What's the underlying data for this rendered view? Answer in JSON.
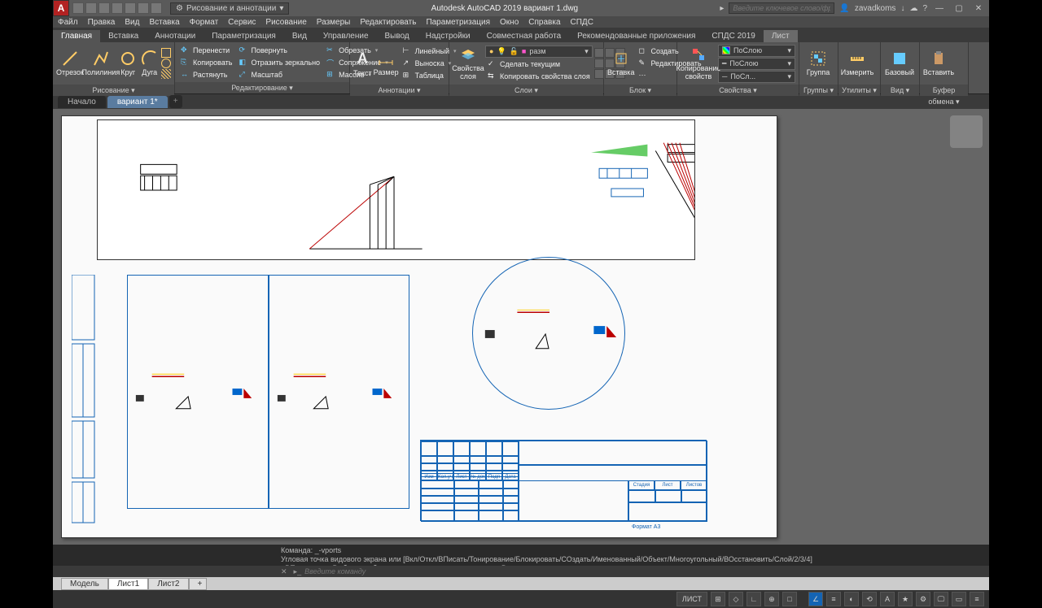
{
  "app_logo": "A",
  "workspace": "Рисование и аннотации",
  "title": "Autodesk AutoCAD 2019   вариант 1.dwg",
  "search_ph": "Введите ключевое слово/фразу",
  "user": "zavadkoms",
  "menu": [
    "Файл",
    "Правка",
    "Вид",
    "Вставка",
    "Формат",
    "Сервис",
    "Рисование",
    "Размеры",
    "Редактировать",
    "Параметризация",
    "Окно",
    "Справка",
    "СПДС"
  ],
  "ribbon_tabs": [
    "Главная",
    "Вставка",
    "Аннотации",
    "Параметризация",
    "Вид",
    "Управление",
    "Вывод",
    "Надстройки",
    "Совместная работа",
    "Рекомендованные приложения",
    "СПДС 2019",
    "Лист"
  ],
  "active_rtab": 0,
  "panels": {
    "draw": {
      "title": "Рисование ▾",
      "btns": [
        "Отрезок",
        "Полилиния",
        "Круг",
        "Дуга"
      ]
    },
    "modify": {
      "title": "Редактирование ▾",
      "items": [
        "Перенести",
        "Повернуть",
        "Обрезать",
        "Копировать",
        "Отразить зеркально",
        "Сопряжение",
        "Растянуть",
        "Масштаб",
        "Массив"
      ]
    },
    "annot": {
      "title": "Аннотации ▾",
      "btns": [
        "Текст",
        "Размер"
      ],
      "items": [
        "Линейный",
        "Выноска",
        "Таблица"
      ]
    },
    "layers": {
      "title": "Слои ▾",
      "btn": "Свойства слоя",
      "items": [
        "разм",
        "Сделать текущим",
        "Копировать свойства слоя"
      ]
    },
    "block": {
      "title": "Блок ▾",
      "btns": [
        "Вставка",
        "Создать",
        "Редактировать"
      ]
    },
    "prop": {
      "title": "Свойства ▾",
      "btn": "Копирование свойств",
      "combos": [
        "ПоСлою",
        "ПоСлою",
        "ПоСл..."
      ]
    },
    "groups": {
      "title": "Группы ▾",
      "btn": "Группа"
    },
    "util": {
      "title": "Утилиты ▾",
      "btn": "Измерить"
    },
    "view": {
      "title": "Вид ▾",
      "btn": "Базовый"
    },
    "clip": {
      "title": "Буфер обмена ▾",
      "btn": "Вставить"
    }
  },
  "file_tabs": {
    "start": "Начало",
    "active": "вариант 1*"
  },
  "format_label": "Формат А3",
  "tb_headers": [
    "Изм",
    "Кол.уч",
    "Лист",
    "№ док",
    "Подп",
    "Дата"
  ],
  "tb_meta": [
    "Стадия",
    "Лист",
    "Листов"
  ],
  "model_tabs": [
    "Модель",
    "Лист1",
    "Лист2",
    "+"
  ],
  "active_model_tab": 1,
  "cmd_hist": [
    "Команда: _-vports",
    "Угловая точка видового экрана или [Вкл/Откл/ВПисать/Тонирование/Блокировать/СОздать/Именованный/Объект/Многоугольный/ВОсстановить/Слой/2/3/4]",
    "<ВПисать>: _o Выберите объект для подрезки видового экрана: Выполняется регенерация модели."
  ],
  "cmd_ph": "Введите команду",
  "status_mode": "ЛИСТ"
}
